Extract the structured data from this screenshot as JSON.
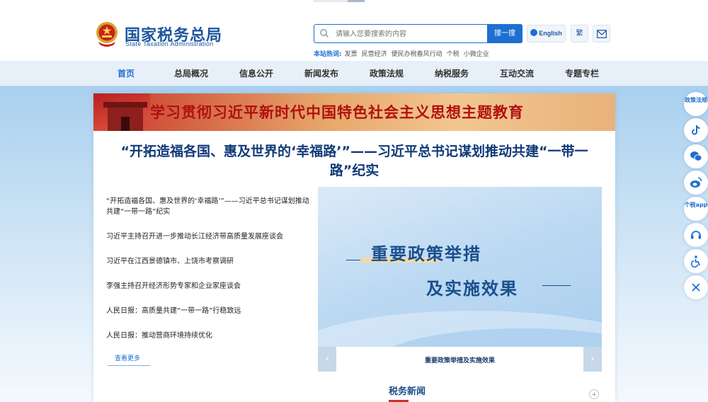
{
  "header": {
    "logo_cn": "国家税务总局",
    "logo_en": "State Taxation Administration",
    "search_placeholder": "请输入您要搜索的内容",
    "search_button": "搜一搜",
    "english_label": "English",
    "traditional_label": "繁",
    "hot_label": "本站热词:",
    "hot_words": [
      "发票",
      "民营经济",
      "便民办税春风行动",
      "个税",
      "小微企业"
    ]
  },
  "nav": {
    "items": [
      "首页",
      "总局概况",
      "信息公开",
      "新闻发布",
      "政策法规",
      "纳税服务",
      "互动交流",
      "专题专栏"
    ],
    "active_index": 0
  },
  "banner": {
    "text": "学习贯彻习近平新时代中国特色社会主义思想主题教育"
  },
  "headline": "“开拓造福各国、惠及世界的‘幸福路’”——习近平总书记谋划推动共建“一带一路”纪实",
  "news_list": [
    "“开拓造福各国、惠及世界的‘幸福路’”——习近平总书记谋划推动共建“一带一路”纪实",
    "习近平主持召开进一步推动长江经济带高质量发展座谈会",
    "习近平在江西景德镇市、上饶市考察调研",
    "李强主持召开经济形势专家和企业家座谈会",
    "人民日报：高质量共建“一带一路”行稳致远",
    "人民日报：推动营商环境持续优化"
  ],
  "more_label": "查看更多",
  "carousel": {
    "line1": "重要政策举措",
    "line2": "及实施效果",
    "caption": "重要政策举措及实施效果",
    "prev": "‹",
    "next": "›"
  },
  "section": {
    "title": "税务新闻"
  },
  "sidebar": {
    "policy_label": "政策法规",
    "app_label": "个税app",
    "icons": [
      "douyin-icon",
      "wechat-icon",
      "weibo-icon",
      "headset-icon",
      "accessibility-icon",
      "close-icon"
    ]
  },
  "colors": {
    "brand_blue": "#1e6fd0",
    "title_navy": "#103a78",
    "accent_red": "#c9302c"
  }
}
